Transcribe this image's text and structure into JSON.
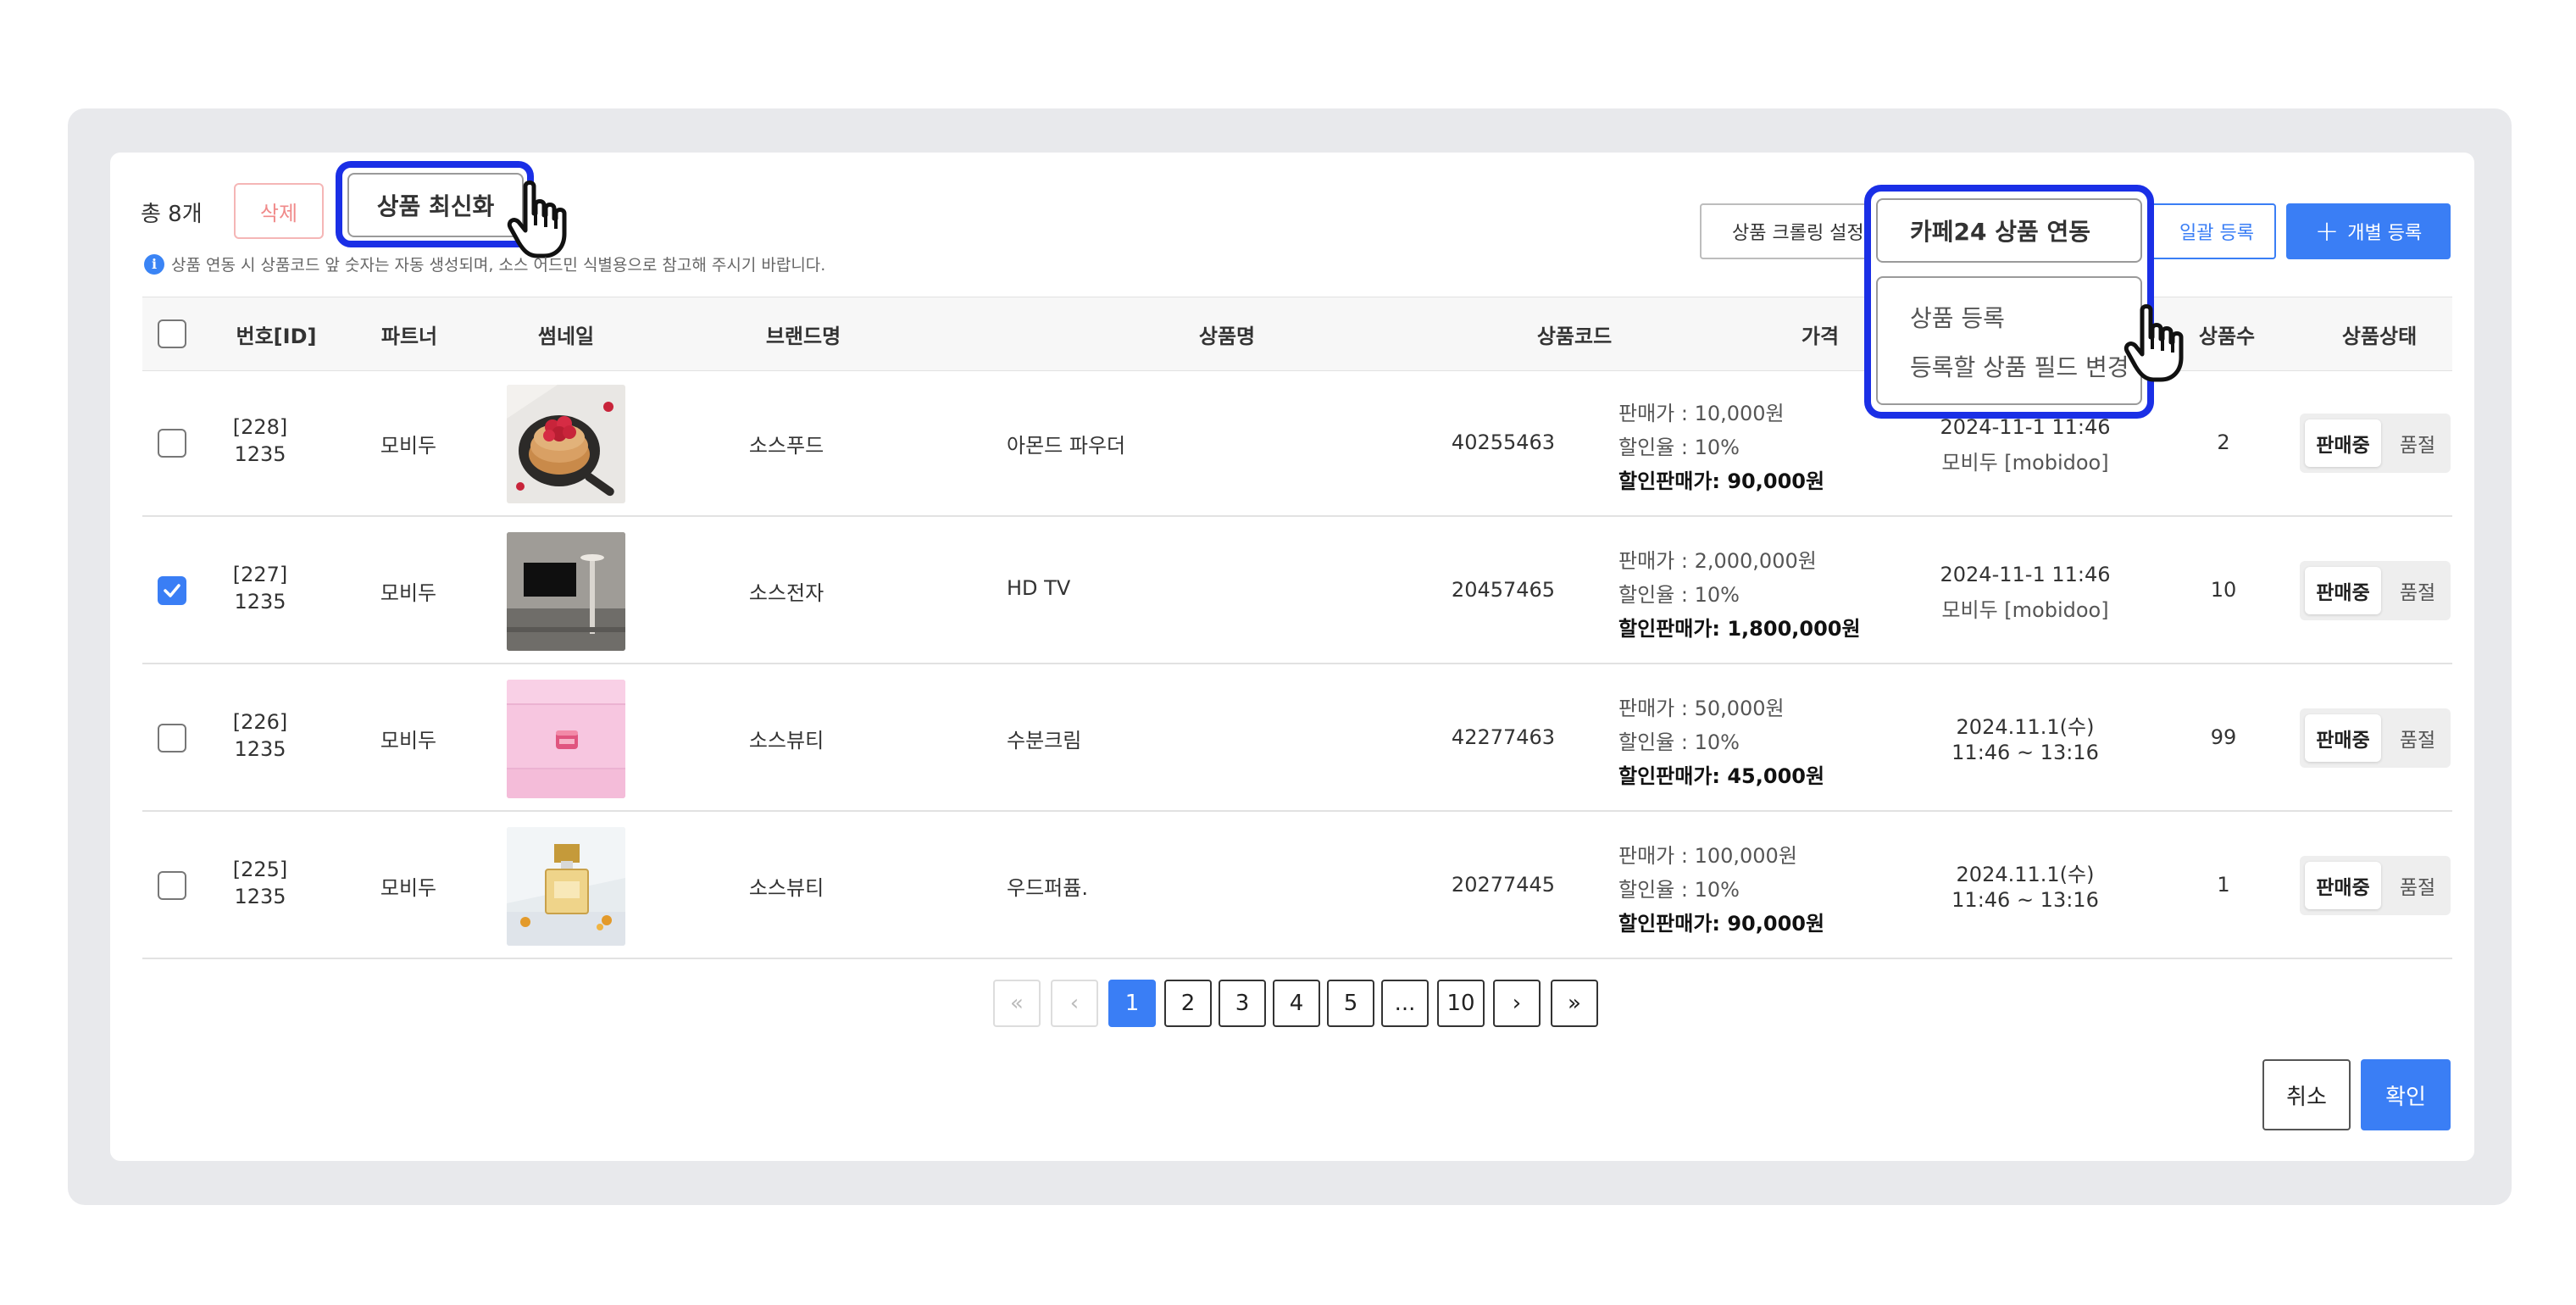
{
  "toolbar": {
    "total_count": "총 8개",
    "delete_label": "삭제",
    "refresh_label": "상품 최신화",
    "notice": "상품 연동 시 상품코드 앞 숫자는 자동 생성되며, 소스 어드민 식별용으로 참고해 주시기 바랍니다.",
    "crawl_label": "상품 크롤링 설정",
    "cafe24_label": "카페24 상품 연동",
    "bulk_label": "일괄 등록",
    "single_label": "개별 등록"
  },
  "cafe24_menu": [
    "상품 등록",
    "등록할 상품 필드 변경"
  ],
  "table": {
    "columns": [
      "번호[ID]",
      "파트너",
      "썸네일",
      "브랜드명",
      "상품명",
      "상품코드",
      "가격",
      "상품수",
      "상품상태"
    ],
    "rows": [
      {
        "id": "[228]",
        "sub_id": "1235",
        "partner": "모비두",
        "thumbnail": "pancake-image",
        "brand": "소스푸드",
        "name": "아몬드 파우더",
        "code": "40255463",
        "price": "판매가 : 10,000원",
        "discount": "할인율 : 10%",
        "sale_price": "할인판매가: 90,000원",
        "date_line1": "2024-11-1 11:46",
        "date_line2": "모비두 [mobidoo]",
        "qty": "2",
        "checked": false,
        "status_on": "판매중",
        "status_off": "품절"
      },
      {
        "id": "[227]",
        "sub_id": "1235",
        "partner": "모비두",
        "thumbnail": "tv-image",
        "brand": "소스전자",
        "name": "HD TV",
        "code": "20457465",
        "price": "판매가 : 2,000,000원",
        "discount": "할인율 : 10%",
        "sale_price": "할인판매가: 1,800,000원",
        "date_line1": "2024-11-1 11:46",
        "date_line2": "모비두 [mobidoo]",
        "qty": "10",
        "checked": true,
        "status_on": "판매중",
        "status_off": "품절"
      },
      {
        "id": "[226]",
        "sub_id": "1235",
        "partner": "모비두",
        "thumbnail": "cream-image",
        "brand": "소스뷰티",
        "name": "수분크림",
        "code": "42277463",
        "price": "판매가 : 50,000원",
        "discount": "할인율 : 10%",
        "sale_price": "할인판매가: 45,000원",
        "date_line1": "2024.11.1(수)",
        "date_line2": "11:46 ~ 13:16",
        "qty": "99",
        "checked": false,
        "status_on": "판매중",
        "status_off": "품절"
      },
      {
        "id": "[225]",
        "sub_id": "1235",
        "partner": "모비두",
        "thumbnail": "perfume-image",
        "brand": "소스뷰티",
        "name": "우드퍼퓸.",
        "code": "20277445",
        "price": "판매가 : 100,000원",
        "discount": "할인율 : 10%",
        "sale_price": "할인판매가: 90,000원",
        "date_line1": "2024.11.1(수)",
        "date_line2": "11:46 ~ 13:16",
        "qty": "1",
        "checked": false,
        "status_on": "판매중",
        "status_off": "품절"
      }
    ]
  },
  "pagination": {
    "first": "«",
    "prev": "‹",
    "pages": [
      "1",
      "2",
      "3",
      "4",
      "5",
      "...",
      "10"
    ],
    "next": "›",
    "last": "»",
    "current": "1"
  },
  "footer": {
    "cancel_label": "취소",
    "confirm_label": "확인"
  },
  "colors": {
    "accent": "#3a7ef5",
    "highlight": "#1a2fe6",
    "delete": "#f08a8a"
  }
}
